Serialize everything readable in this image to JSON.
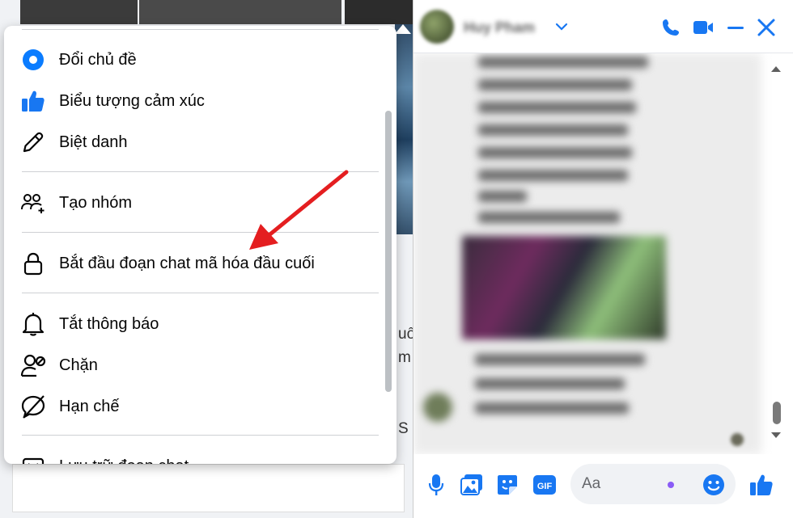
{
  "colors": {
    "accent": "#0a7cff",
    "messenger_blue": "#1877f2",
    "arrow_red": "#e41e20",
    "icon_dark": "#050505"
  },
  "menu": {
    "items": [
      {
        "label": "Đổi chủ đề",
        "icon": "theme-circle-icon"
      },
      {
        "label": "Biểu tượng cảm xúc",
        "icon": "thumbs-up-icon"
      },
      {
        "label": "Biệt danh",
        "icon": "pencil-icon"
      },
      {
        "label": "Tạo nhóm",
        "icon": "create-group-icon"
      },
      {
        "label": "Bắt đầu đoạn chat mã hóa đầu cuối",
        "icon": "lock-icon"
      },
      {
        "label": "Tắt thông báo",
        "icon": "bell-icon"
      },
      {
        "label": "Chặn",
        "icon": "block-user-icon"
      },
      {
        "label": "Hạn chế",
        "icon": "restrict-icon"
      },
      {
        "label": "Lưu trữ đoạn chat",
        "icon": "archive-icon"
      }
    ]
  },
  "background": {
    "fragment_1": "uố",
    "fragment_2": "m",
    "fragment_3": "S"
  },
  "chat": {
    "contact_name": "Huy Pham",
    "header_icons": [
      "chevron-down-icon",
      "phone-icon",
      "video-icon",
      "minimize-icon",
      "close-icon"
    ],
    "footer_icons": [
      "microphone-icon",
      "photo-icon",
      "sticker-icon",
      "gif-icon",
      "emoji-icon",
      "like-icon"
    ],
    "gif_label": "GIF",
    "input_placeholder": "Aa"
  }
}
